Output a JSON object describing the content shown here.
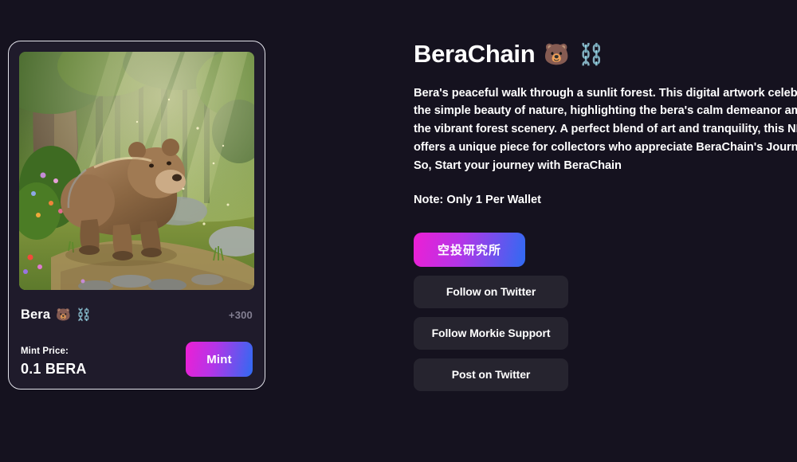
{
  "theme": {
    "background": "#15121f",
    "card_background": "#1f1b2b",
    "card_border": "#e2e2ea",
    "button_neutral": "#26242f",
    "gradient_from": "#ed1fd4",
    "gradient_to": "#2f6bf2",
    "muted_text": "#837f92"
  },
  "card": {
    "artwork_name": "bear-in-sunlit-forest-illustration",
    "title": "Bera",
    "title_emoji_bear": "🐻",
    "title_emoji_chains": "⛓️",
    "badge": "+300",
    "price_label": "Mint Price:",
    "price_value": "0.1 BERA",
    "mint_button": "Mint"
  },
  "detail": {
    "title": "BeraChain",
    "title_emoji_bear": "🐻",
    "title_emoji_chains": "⛓️",
    "description": "Bera's peaceful walk through a sunlit forest. This digital artwork celebrates the simple beauty of nature, highlighting the bera's calm demeanor amidst the vibrant forest scenery. A perfect blend of art and tranquility, this NFT offers a unique piece for collectors who appreciate BeraChain's Journey. So, Start your journey with BeraChain",
    "note": "Note: Only 1 Per Wallet",
    "buttons": {
      "airdrop": "空投研究所",
      "follow_twitter": "Follow on Twitter",
      "follow_morkie": "Follow Morkie Support",
      "post_twitter": "Post on Twitter"
    }
  }
}
